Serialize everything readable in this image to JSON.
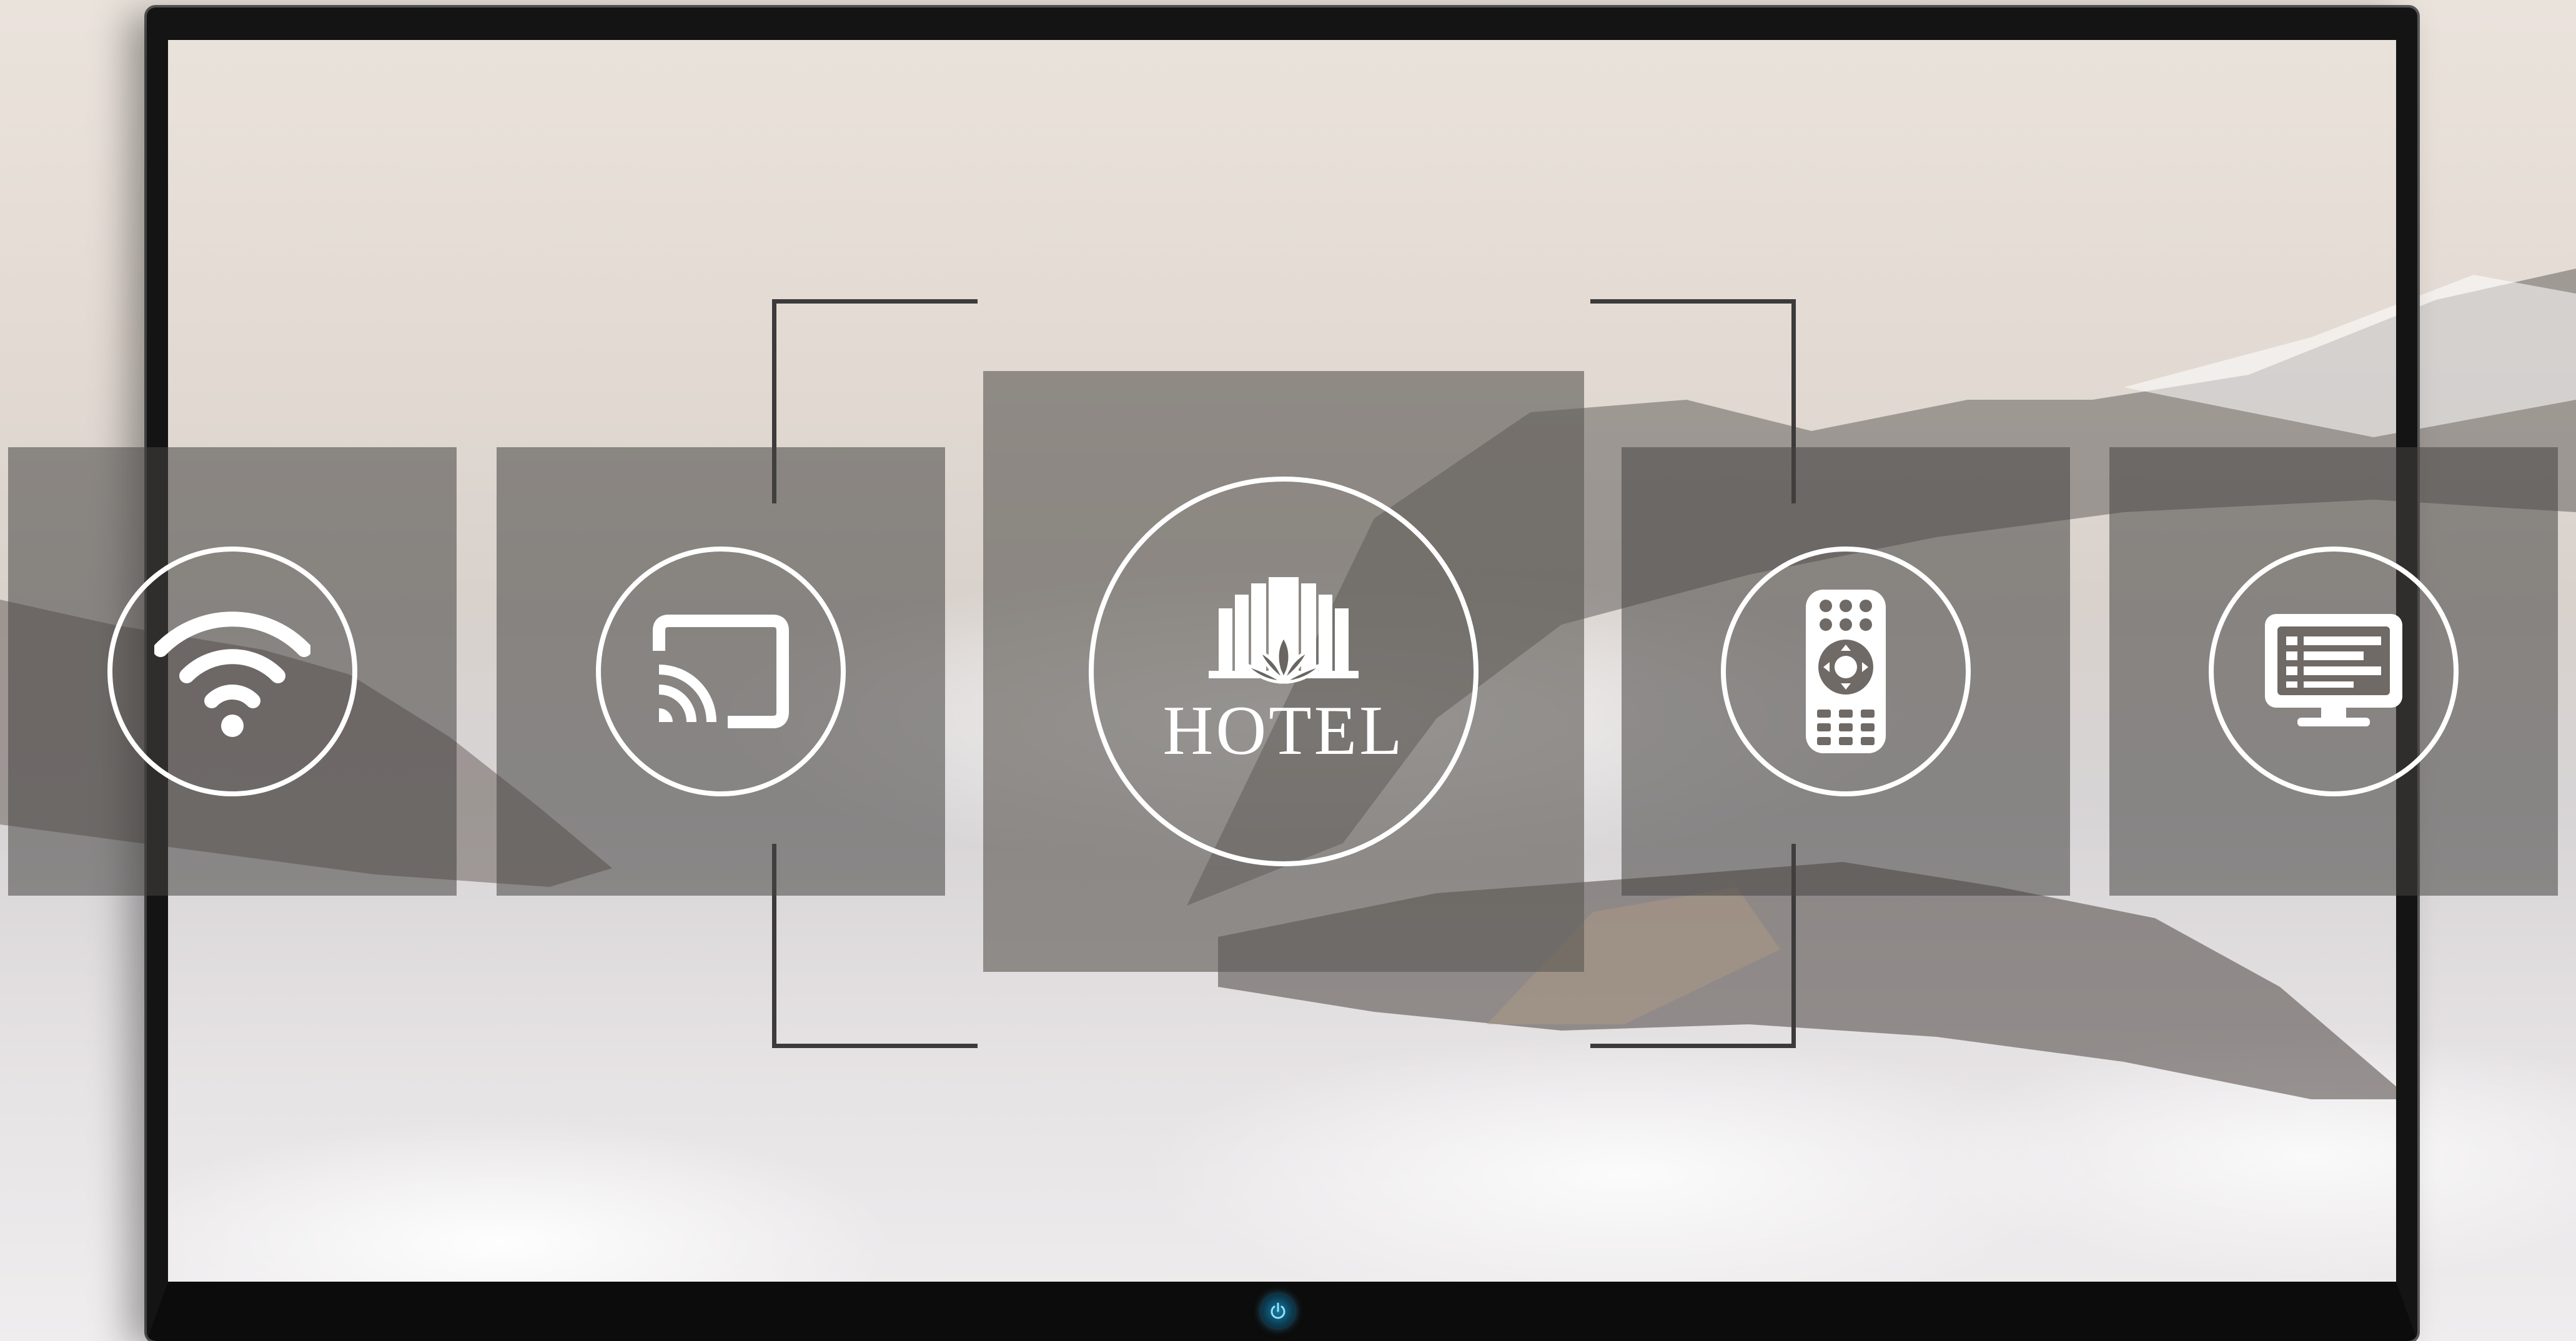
{
  "screen": {
    "brand_label": "HOTEL",
    "tiles": [
      {
        "id": "wifi",
        "icon": "wifi-icon"
      },
      {
        "id": "cast",
        "icon": "cast-icon"
      },
      {
        "id": "hotel",
        "icon": "hotel-logo-icon"
      },
      {
        "id": "remote",
        "icon": "remote-control-icon"
      },
      {
        "id": "tv-guide",
        "icon": "tv-guide-icon"
      }
    ]
  },
  "device": {
    "power_icon": "power-icon",
    "power_indicator_color": "#3ab4e6",
    "bezel_color": "#141414"
  },
  "theme": {
    "tile_color": "#464442",
    "icon_color": "#ffffff",
    "bracket_color": "#3c3a3a"
  }
}
